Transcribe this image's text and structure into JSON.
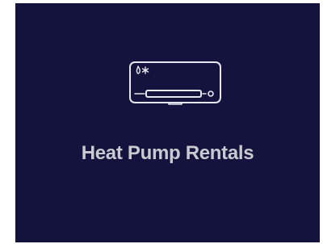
{
  "card": {
    "title": "Heat Pump Rentals",
    "icon": "air-conditioner-icon",
    "background_color": "#13133d",
    "text_color": "#c9c9d1"
  }
}
